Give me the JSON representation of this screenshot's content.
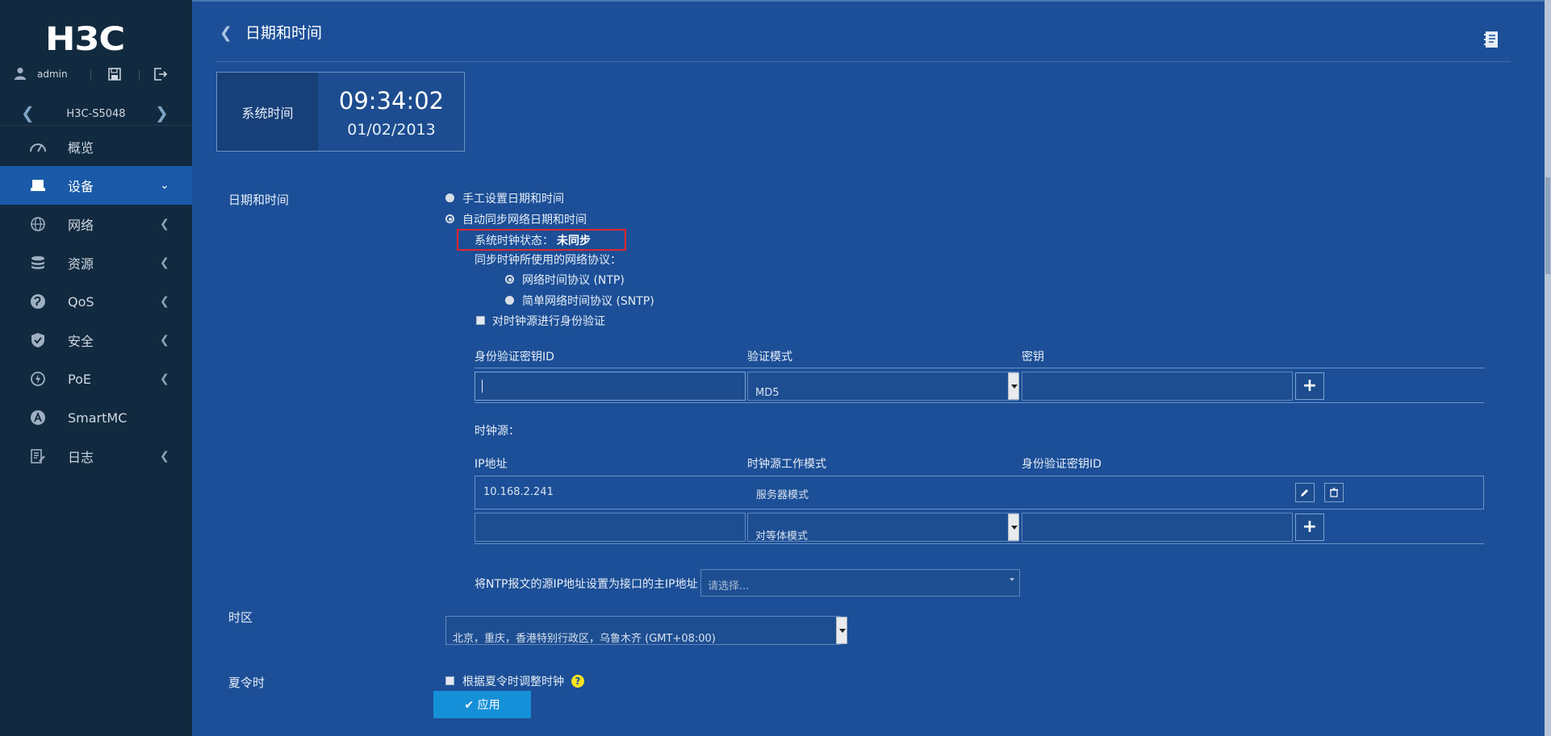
{
  "sidebar": {
    "logo": "H3C",
    "user": "admin",
    "device": "H3C-S5048",
    "items": [
      {
        "label": "概览",
        "icon": "dashboard-icon"
      },
      {
        "label": "设备",
        "icon": "device-icon"
      },
      {
        "label": "网络",
        "icon": "globe-icon"
      },
      {
        "label": "资源",
        "icon": "database-icon"
      },
      {
        "label": "QoS",
        "icon": "qos-icon"
      },
      {
        "label": "安全",
        "icon": "shield-icon"
      },
      {
        "label": "PoE",
        "icon": "poe-icon"
      },
      {
        "label": "SmartMC",
        "icon": "smartmc-icon"
      },
      {
        "label": "日志",
        "icon": "log-icon"
      }
    ]
  },
  "header": {
    "title": "日期和时间"
  },
  "clock": {
    "label": "系统时间",
    "time": "09:34:02",
    "date": "01/02/2013"
  },
  "datetime": {
    "section_label": "日期和时间",
    "manual_label": "手工设置日期和时间",
    "auto_label": "自动同步网络日期和时间",
    "status_prefix": "系统时钟状态：",
    "status_value": "未同步",
    "protocol_label": "同步时钟所使用的网络协议：",
    "ntp_label": "网络时间协议 (NTP)",
    "sntp_label": "简单网络时间协议 (SNTP)",
    "auth_label": "对时钟源进行身份验证"
  },
  "auth_table": {
    "col_key_id": "身份验证密钥ID",
    "col_mode": "验证模式",
    "col_key": "密钥",
    "mode_value": "MD5"
  },
  "clock_source": {
    "label": "时钟源：",
    "col_ip": "IP地址",
    "col_mode": "时钟源工作模式",
    "col_key_id": "身份验证密钥ID",
    "row_ip": "10.168.2.241",
    "row_mode": "服务器模式",
    "new_mode_value": "对等体模式"
  },
  "ntp_source": {
    "label": "将NTP报文的源IP地址设置为接口的主IP地址",
    "placeholder": "请选择..."
  },
  "timezone": {
    "label": "时区",
    "value": "北京，重庆，香港特别行政区，乌鲁木齐  (GMT+08:00)"
  },
  "dst": {
    "label": "夏令时",
    "checkbox_label": "根据夏令时调整时钟",
    "help": "?"
  },
  "apply_label": "✔ 应用"
}
